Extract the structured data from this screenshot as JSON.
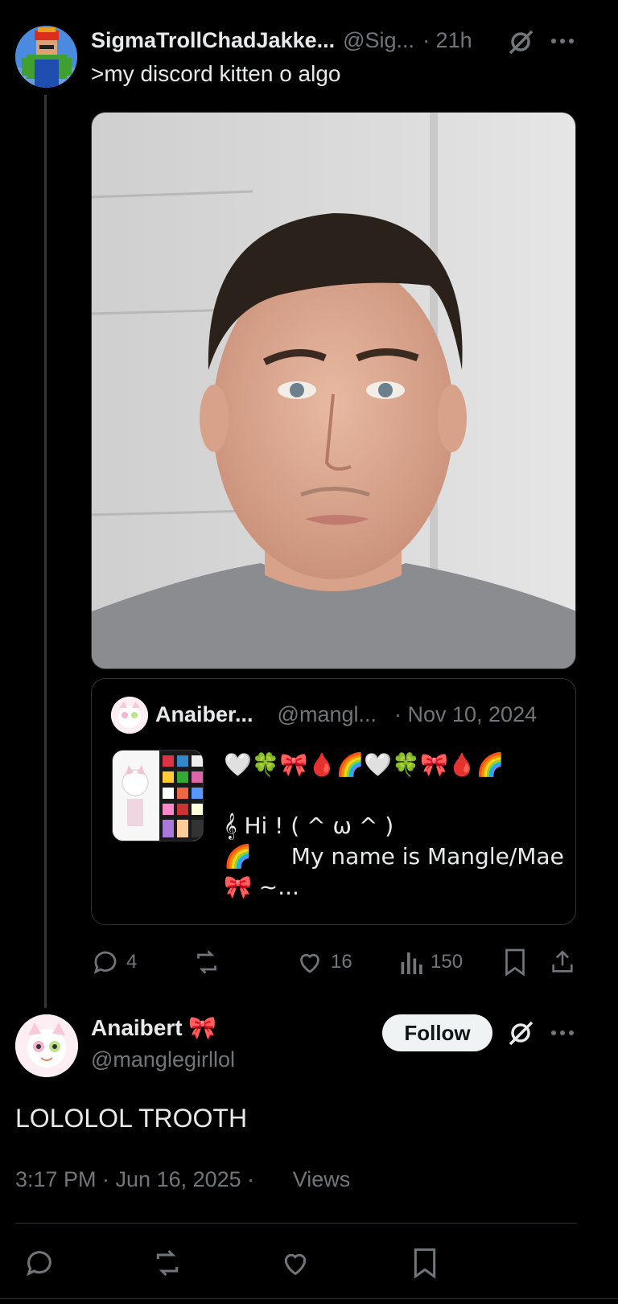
{
  "parent_post": {
    "display_name": "SigmaTrollChadJakke...",
    "handle": "@Sig...",
    "time": "· 21h",
    "text": ">my discord kitten o algo",
    "avatar_icon": "pixel-avatar-icon",
    "grok_icon": "grok-icon",
    "more_icon": "more-dots-icon",
    "quoted_post": {
      "display_name": "Anaiber...",
      "handle": "@mangl...",
      "date": "· Nov 10, 2024",
      "emoji_line": "🤍🍀🎀🩸🌈🤍🍀🎀🩸🌈",
      "line2": "𝄞 Hi !   ( ^ ω ^ )",
      "line3_emoji": "🌈",
      "line3_text": "My name is Mangle/Mae",
      "line4": "🎀 ~..."
    },
    "actions": {
      "replies": "4",
      "reposts": "",
      "likes": "16",
      "views": "150"
    }
  },
  "reply": {
    "display_name": "Anaibert 🎀",
    "handle": "@manglegirllol",
    "follow_label": "Follow",
    "text": "LOLOLOL TROOTH",
    "timestamp": "3:17 PM · Jun 16, 2025 ·",
    "views_label": "Views"
  },
  "colors": {
    "background": "#000000",
    "text": "#e7e9ea",
    "muted": "#71767b",
    "border": "#2f3336"
  }
}
